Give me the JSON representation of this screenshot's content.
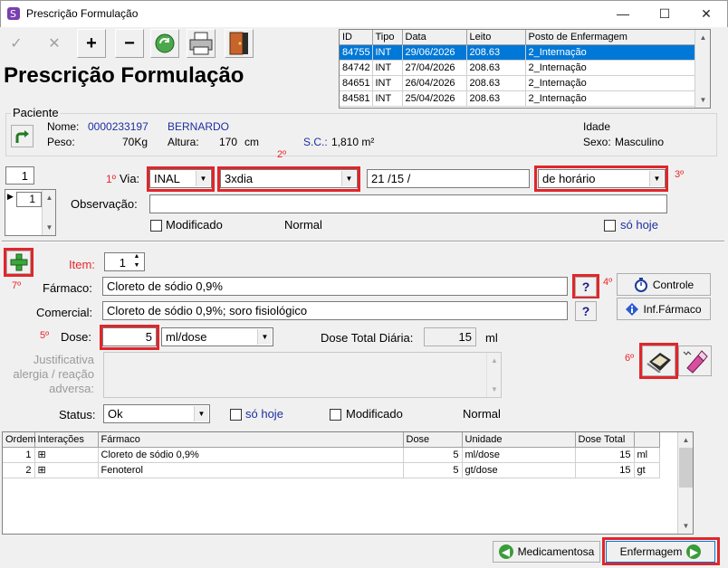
{
  "window": {
    "title": "Prescrição Formulação",
    "minimize": "—",
    "maximize": "☐",
    "close": "✕"
  },
  "toolbar": {
    "confirm_icon": "check-icon",
    "cancel_icon": "x-icon",
    "add": "+",
    "remove": "−"
  },
  "history": {
    "columns": [
      "ID",
      "Tipo",
      "Data",
      "Leito",
      "Posto de Enfermagem"
    ],
    "rows": [
      [
        "84755",
        "INT",
        "29/06/2026",
        "208.63",
        "2_Internação"
      ],
      [
        "84742",
        "INT",
        "27/04/2026",
        "208.63",
        "2_Internação"
      ],
      [
        "84651",
        "INT",
        "26/04/2026",
        "208.63",
        "2_Internação"
      ],
      [
        "84581",
        "INT",
        "25/04/2026",
        "208.63",
        "2_Internação"
      ]
    ],
    "selected_row": 0
  },
  "page_title": "Prescrição Formulação",
  "patient": {
    "group_label": "Paciente",
    "nome_label": "Nome:",
    "nome_id": "0000233197",
    "nome": "BERNARDO",
    "peso_label": "Peso:",
    "peso": "70Kg",
    "altura_label": "Altura:",
    "altura": "170",
    "altura_unit": "cm",
    "sc_label": "S.C.:",
    "sc": "1,810 m²",
    "idade_label": "Idade",
    "sexo_label": "Sexo:",
    "sexo": "Masculino"
  },
  "left_spin": {
    "value": "1",
    "list_value": "1"
  },
  "via_row": {
    "marker1": "1º",
    "via_label": "Via:",
    "via_value": "INAL",
    "marker2": "2º",
    "freq_value": "3xdia",
    "date_value": "21  /15  /",
    "marker3": "3º",
    "horario_value": "de horário"
  },
  "observacao": {
    "label": "Observação:",
    "value": "",
    "modificado": "Modificado",
    "normal": "Normal",
    "so_hoje": "só hoje"
  },
  "item": {
    "marker7": "7º",
    "item_label": "Item:",
    "item_value": "1",
    "farmaco_label": "Fármaco:",
    "farmaco_value": "Cloreto de sódio 0,9%",
    "marker4": "4º",
    "help": "?",
    "comercial_label": "Comercial:",
    "comercial_value": "Cloreto de sódio 0,9%; soro fisiológico",
    "controle": "Controle",
    "inf_farmaco": "Inf.Fármaco",
    "marker5": "5º",
    "dose_label": "Dose:",
    "dose_value": "5",
    "dose_unit": "ml/dose",
    "dose_total_label": "Dose Total Diária:",
    "dose_total_value": "15",
    "dose_total_unit": "ml",
    "justificativa_label_1": "Justificativa",
    "justificativa_label_2": "alergia / reação",
    "justificativa_label_3": "adversa:",
    "marker6": "6º",
    "status_label": "Status:",
    "status_value": "Ok",
    "so_hoje": "só hoje",
    "modificado": "Modificado",
    "normal": "Normal"
  },
  "items_table": {
    "columns": [
      "Ordem",
      "Interações",
      "Fármaco",
      "Dose",
      "Unidade",
      "Dose Total",
      ""
    ],
    "rows": [
      [
        "1",
        "⊞",
        "Cloreto de sódio 0,9%",
        "5",
        "ml/dose",
        "15",
        "ml"
      ],
      [
        "2",
        "⊞",
        "Fenoterol",
        "5",
        "gt/dose",
        "15",
        "gt"
      ]
    ]
  },
  "footer": {
    "medicamentosa": "Medicamentosa",
    "enfermagem": "Enfermagem"
  },
  "colors": {
    "accent_red": "#e0262b",
    "selection": "#0078d7",
    "patient_blue": "#1d2fa0"
  }
}
